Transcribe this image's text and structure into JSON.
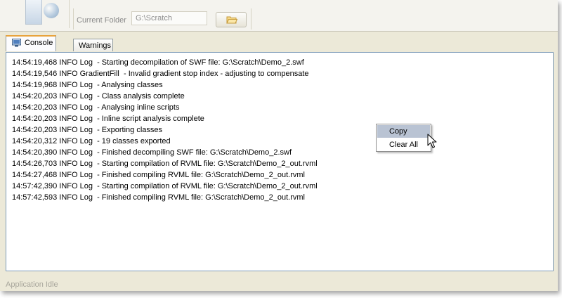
{
  "toolbar": {
    "folder_label": "Current Folder",
    "folder_value": "G:\\Scratch"
  },
  "tabs": [
    {
      "label": "Console",
      "active": true
    },
    {
      "label": "Warnings",
      "active": false
    }
  ],
  "console": {
    "lines": [
      "14:54:19,468 INFO Log  - Starting decompilation of SWF file: G:\\Scratch\\Demo_2.swf",
      "14:54:19,546 INFO GradientFill  - Invalid gradient stop index - adjusting to compensate",
      "14:54:19,968 INFO Log  - Analysing classes",
      "14:54:20,203 INFO Log  - Class analysis complete",
      "14:54:20,203 INFO Log  - Analysing inline scripts",
      "14:54:20,203 INFO Log  - Inline script analysis complete",
      "14:54:20,203 INFO Log  - Exporting classes",
      "14:54:20,312 INFO Log  - 19 classes exported",
      "14:54:20,390 INFO Log  - Finished decompiling SWF file: G:\\Scratch\\Demo_2.swf",
      "14:54:26,703 INFO Log  - Starting compilation of RVML file: G:\\Scratch\\Demo_2_out.rvml",
      "14:54:27,468 INFO Log  - Finished compiling RVML file: G:\\Scratch\\Demo_2_out.rvml",
      "14:57:42,390 INFO Log  - Starting compilation of RVML file: G:\\Scratch\\Demo_2_out.rvml",
      "14:57:42,593 INFO Log  - Finished compiling RVML file: G:\\Scratch\\Demo_2_out.rvml"
    ]
  },
  "context_menu": {
    "items": [
      {
        "label": "Copy",
        "highlighted": true
      },
      {
        "label": "Clear All",
        "highlighted": false
      }
    ]
  },
  "status": {
    "text": "Application Idle"
  },
  "icons": {
    "open_folder": "folder-open-icon",
    "console_tab": "monitor-icon"
  },
  "colors": {
    "active_tab_accent": "#e8a33d",
    "menu_highlight": "#b9c3d3",
    "panel_border": "#7f9db9"
  }
}
